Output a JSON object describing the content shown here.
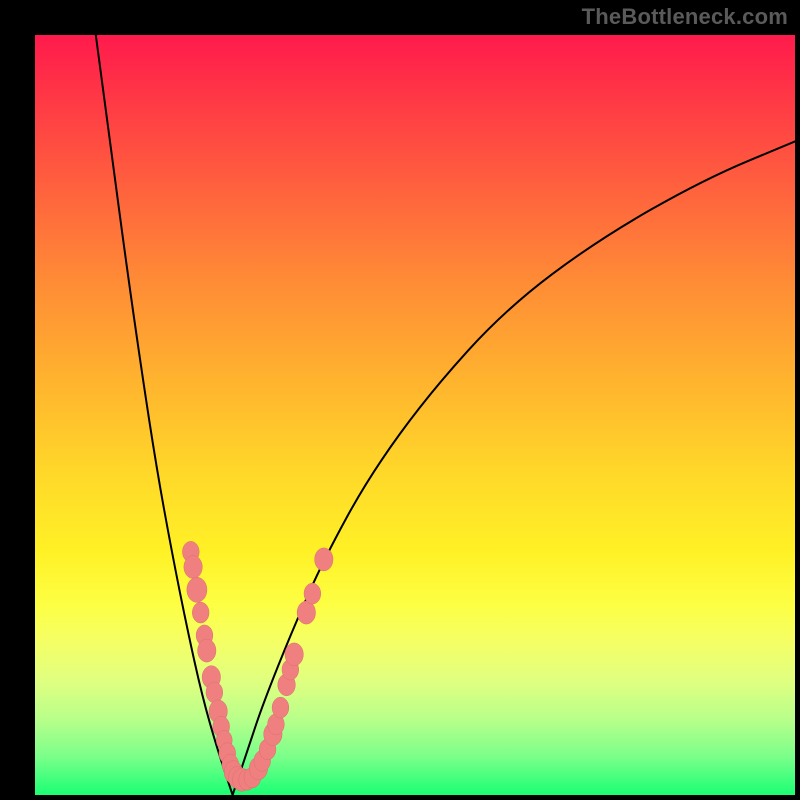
{
  "watermark": "TheBottleneck.com",
  "colors": {
    "frame": "#000000",
    "curve": "#000000",
    "marker_fill": "#f08080",
    "marker_edge": "#d86f6f",
    "watermark_text": "#5a5a5a"
  },
  "chart_data": {
    "type": "line",
    "title": "",
    "xlabel": "",
    "ylabel": "",
    "xlim": [
      0,
      100
    ],
    "ylim": [
      0,
      100
    ],
    "grid": false,
    "legend": false,
    "note": "Axis values are estimated from curve geometry; the source image has no tick labels. y ≈ bottleneck percentage, x ≈ component balance parameter. Curve minimum ≈ (26, 0).",
    "series": [
      {
        "name": "left-branch",
        "x": [
          8,
          10,
          12,
          14,
          16,
          18,
          20,
          22,
          24,
          26
        ],
        "y": [
          100,
          85,
          70,
          56,
          43,
          32,
          22,
          13,
          6,
          0
        ]
      },
      {
        "name": "right-branch",
        "x": [
          26,
          28,
          30,
          34,
          38,
          44,
          52,
          62,
          74,
          88,
          100
        ],
        "y": [
          0,
          6,
          12,
          22,
          31,
          42,
          53,
          64,
          73,
          81,
          86
        ]
      }
    ],
    "markers": [
      {
        "x": 20.5,
        "y": 32,
        "r": 2.0
      },
      {
        "x": 20.8,
        "y": 30,
        "r": 2.2
      },
      {
        "x": 21.3,
        "y": 27,
        "r": 2.4
      },
      {
        "x": 21.8,
        "y": 24,
        "r": 2.0
      },
      {
        "x": 22.3,
        "y": 21,
        "r": 2.0
      },
      {
        "x": 22.6,
        "y": 19,
        "r": 2.2
      },
      {
        "x": 23.2,
        "y": 15.5,
        "r": 2.2
      },
      {
        "x": 23.6,
        "y": 13.5,
        "r": 2.0
      },
      {
        "x": 24.1,
        "y": 11,
        "r": 2.2
      },
      {
        "x": 24.5,
        "y": 9,
        "r": 2.0
      },
      {
        "x": 24.9,
        "y": 7.2,
        "r": 1.9
      },
      {
        "x": 25.3,
        "y": 5.5,
        "r": 2.0
      },
      {
        "x": 25.7,
        "y": 4.0,
        "r": 2.0
      },
      {
        "x": 26.1,
        "y": 3.0,
        "r": 2.2
      },
      {
        "x": 26.6,
        "y": 2.3,
        "r": 2.1
      },
      {
        "x": 27.2,
        "y": 2.0,
        "r": 2.2
      },
      {
        "x": 27.9,
        "y": 2.0,
        "r": 2.0
      },
      {
        "x": 28.6,
        "y": 2.3,
        "r": 2.0
      },
      {
        "x": 29.4,
        "y": 3.5,
        "r": 2.2
      },
      {
        "x": 29.9,
        "y": 4.5,
        "r": 2.0
      },
      {
        "x": 30.6,
        "y": 6.0,
        "r": 2.0
      },
      {
        "x": 31.3,
        "y": 8.0,
        "r": 2.2
      },
      {
        "x": 31.7,
        "y": 9.3,
        "r": 2.0
      },
      {
        "x": 32.3,
        "y": 11.5,
        "r": 2.0
      },
      {
        "x": 33.1,
        "y": 14.5,
        "r": 2.1
      },
      {
        "x": 33.6,
        "y": 16.5,
        "r": 2.0
      },
      {
        "x": 34.1,
        "y": 18.5,
        "r": 2.2
      },
      {
        "x": 35.7,
        "y": 24.0,
        "r": 2.2
      },
      {
        "x": 36.5,
        "y": 26.5,
        "r": 2.0
      },
      {
        "x": 38.0,
        "y": 31.0,
        "r": 2.2
      }
    ]
  }
}
